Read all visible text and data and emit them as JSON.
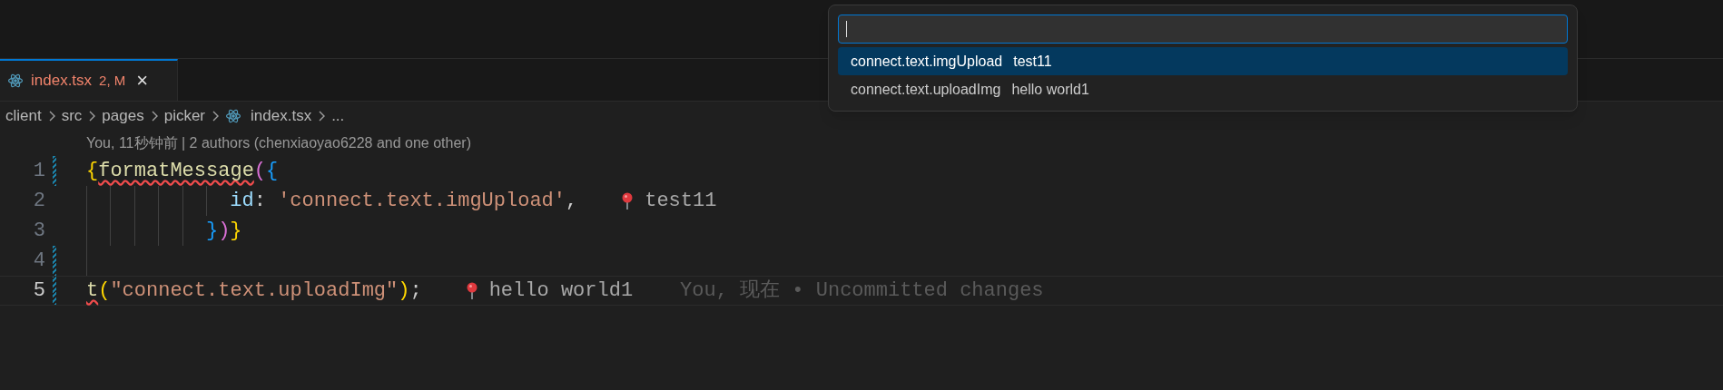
{
  "tab": {
    "label": "index.tsx",
    "status": "2, M",
    "close": "×",
    "selected": true
  },
  "breadcrumbs": [
    {
      "label": "client",
      "kind": "folder"
    },
    {
      "label": "src",
      "kind": "folder"
    },
    {
      "label": "pages",
      "kind": "folder"
    },
    {
      "label": "picker",
      "kind": "folder"
    },
    {
      "label": "index.tsx",
      "kind": "file"
    },
    {
      "label": "...",
      "kind": "more"
    }
  ],
  "codelens": "You, 11秒钟前 | 2 authors (chenxiaoyao6228 and one other)",
  "lines": [
    {
      "number": "1",
      "active": false,
      "modified": true,
      "tokens": [
        {
          "text": "{",
          "kind": "bracket1"
        },
        {
          "text": "formatMessage",
          "kind": "function",
          "error": true
        },
        {
          "text": "(",
          "kind": "bracket2"
        },
        {
          "text": "{",
          "kind": "bracket3"
        }
      ]
    },
    {
      "number": "2",
      "active": false,
      "modified": false,
      "indent_guides": [
        {
          "active": false
        },
        {
          "active": false
        },
        {
          "active": false
        },
        {
          "active": false
        },
        {
          "active": false
        },
        {
          "active": false
        }
      ],
      "tokens": [
        {
          "text": "id",
          "kind": "property"
        },
        {
          "text": ": ",
          "kind": "plain"
        },
        {
          "text": "'connect.text.imgUpload'",
          "kind": "string"
        },
        {
          "text": ",",
          "kind": "plain"
        }
      ],
      "hint": "test11"
    },
    {
      "number": "3",
      "active": false,
      "modified": false,
      "indent_guides": [
        {
          "active": false
        },
        {
          "active": false
        },
        {
          "active": false
        },
        {
          "active": false
        },
        {
          "active": false
        }
      ],
      "tokens": [
        {
          "text": "}",
          "kind": "bracket3"
        },
        {
          "text": ")",
          "kind": "bracket2"
        },
        {
          "text": "}",
          "kind": "bracket1"
        }
      ]
    },
    {
      "number": "4",
      "active": false,
      "modified": true,
      "indent_guides": [
        {
          "active": false
        }
      ]
    },
    {
      "number": "5",
      "active": true,
      "modified": true,
      "tokens": [
        {
          "text": "t",
          "kind": "function",
          "error": true
        },
        {
          "text": "(",
          "kind": "bracket1"
        },
        {
          "text": "\"connect.text.uploadImg\"",
          "kind": "string"
        },
        {
          "text": ")",
          "kind": "bracket1"
        },
        {
          "text": ";",
          "kind": "plain"
        }
      ],
      "hint": "hello world1",
      "blame": "You, 现在 • Uncommitted changes"
    }
  ],
  "quick_pick": {
    "items": [
      {
        "label": "connect.text.imgUpload",
        "description": "test11",
        "selected": true
      },
      {
        "label": "connect.text.uploadImg",
        "description": "hello world1",
        "selected": false
      }
    ]
  }
}
